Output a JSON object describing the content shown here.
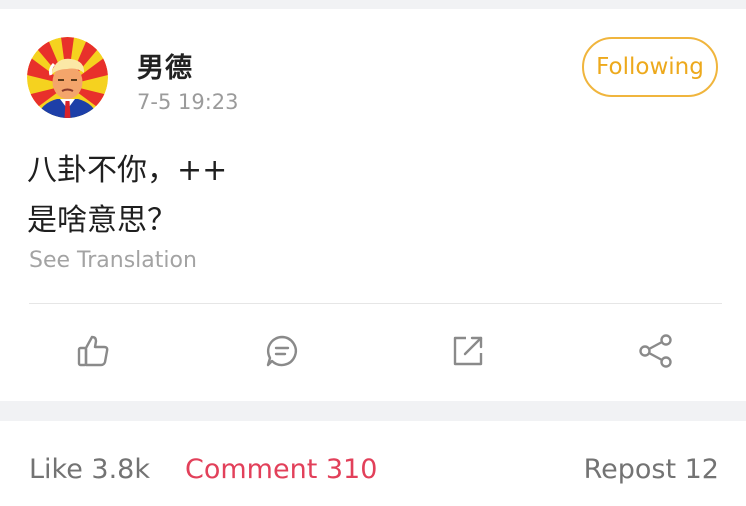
{
  "post": {
    "username": "男德",
    "timestamp": "7-5 19:23",
    "follow_label": "Following",
    "text_lines": [
      "八卦不你，++",
      "是啥意思？"
    ],
    "see_translation": "See Translation"
  },
  "actions": {
    "like_icon": "thumbs-up-icon",
    "comment_icon": "comment-bubble-icon",
    "repost_icon": "repost-arrow-icon",
    "share_icon": "share-icon"
  },
  "stats": {
    "like": "Like 3.8k",
    "comment": "Comment 310",
    "repost": "Repost 12"
  },
  "colors": {
    "follow_accent": "#eda91c",
    "comment_active": "#e2405a",
    "muted_text": "#9b9b9b",
    "band_background": "#f1f2f4"
  }
}
